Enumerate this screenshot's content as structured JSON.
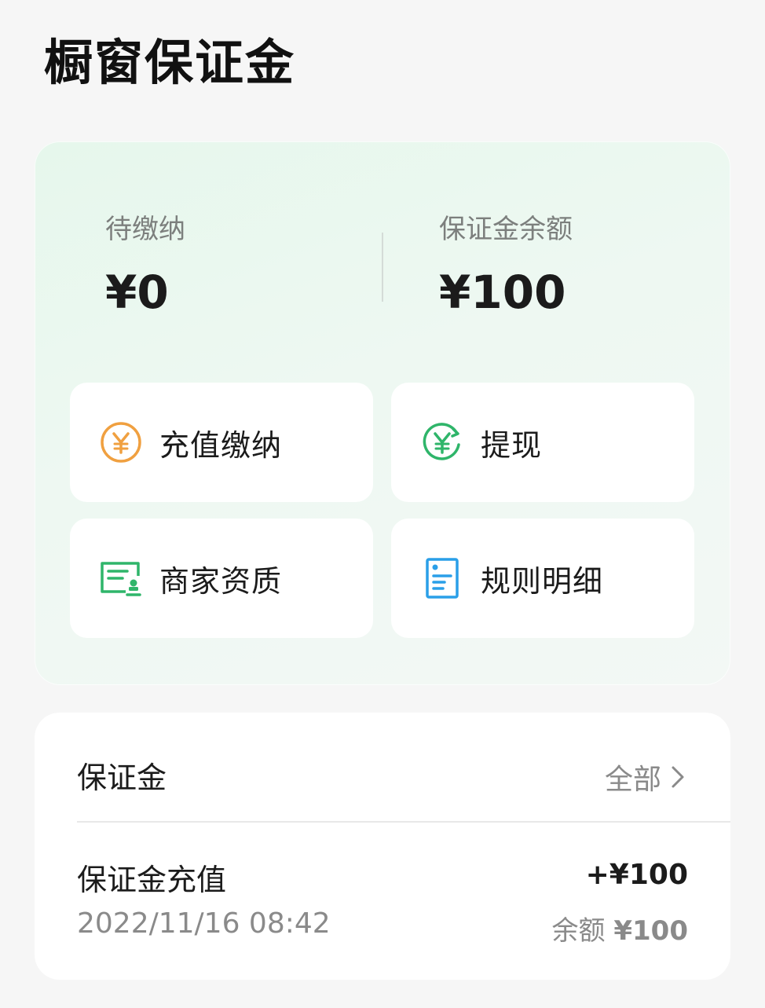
{
  "page": {
    "title": "橱窗保证金"
  },
  "summary": {
    "pending_label": "待缴纳",
    "pending_value": "¥0",
    "balance_label": "保证金余额",
    "balance_value": "¥100"
  },
  "actions": [
    {
      "label": "充值缴纳",
      "icon": "yen-coin-icon",
      "color": "#f0a040"
    },
    {
      "label": "提现",
      "icon": "yen-refresh-icon",
      "color": "#2fb56a"
    },
    {
      "label": "商家资质",
      "icon": "certificate-icon",
      "color": "#2fb56a"
    },
    {
      "label": "规则明细",
      "icon": "document-icon",
      "color": "#2a9fe8"
    }
  ],
  "deposit": {
    "header": "保证金",
    "all_label": "全部",
    "record": {
      "title": "保证金充值",
      "date": "2022/11/16 08:42",
      "amount": "+¥100",
      "balance_label": "余额",
      "balance_value": "¥100"
    }
  }
}
